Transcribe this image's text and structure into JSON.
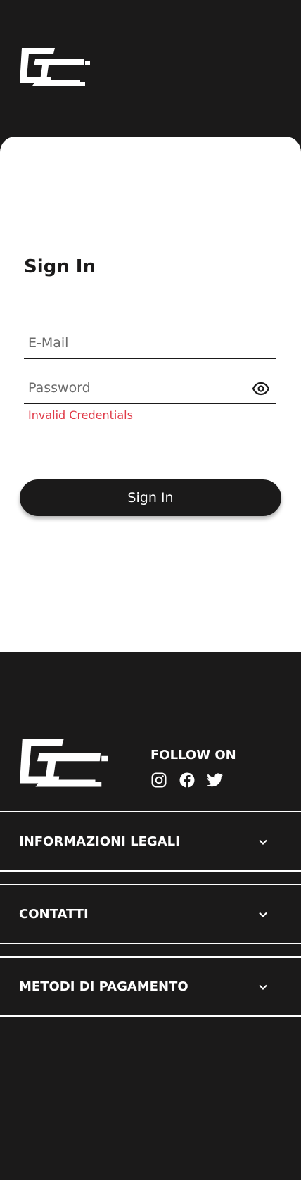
{
  "header": {
    "logo": "cc-logo-icon"
  },
  "signin": {
    "title": "Sign In",
    "email_placeholder": "E-Mail",
    "email_value": "",
    "password_placeholder": "Password",
    "password_value": "",
    "error": "Invalid Credentials",
    "button_label": "Sign In"
  },
  "footer": {
    "follow_label": "FOLLOW ON",
    "socials": [
      "instagram-icon",
      "facebook-icon",
      "twitter-icon"
    ],
    "sections": [
      {
        "label": "INFORMAZIONI LEGALI"
      },
      {
        "label": "CONTATTI"
      },
      {
        "label": "METODI DI PAGAMENTO"
      }
    ]
  },
  "colors": {
    "dark": "#1b1a1a",
    "card": "#ffffff",
    "error": "#e03a48"
  }
}
